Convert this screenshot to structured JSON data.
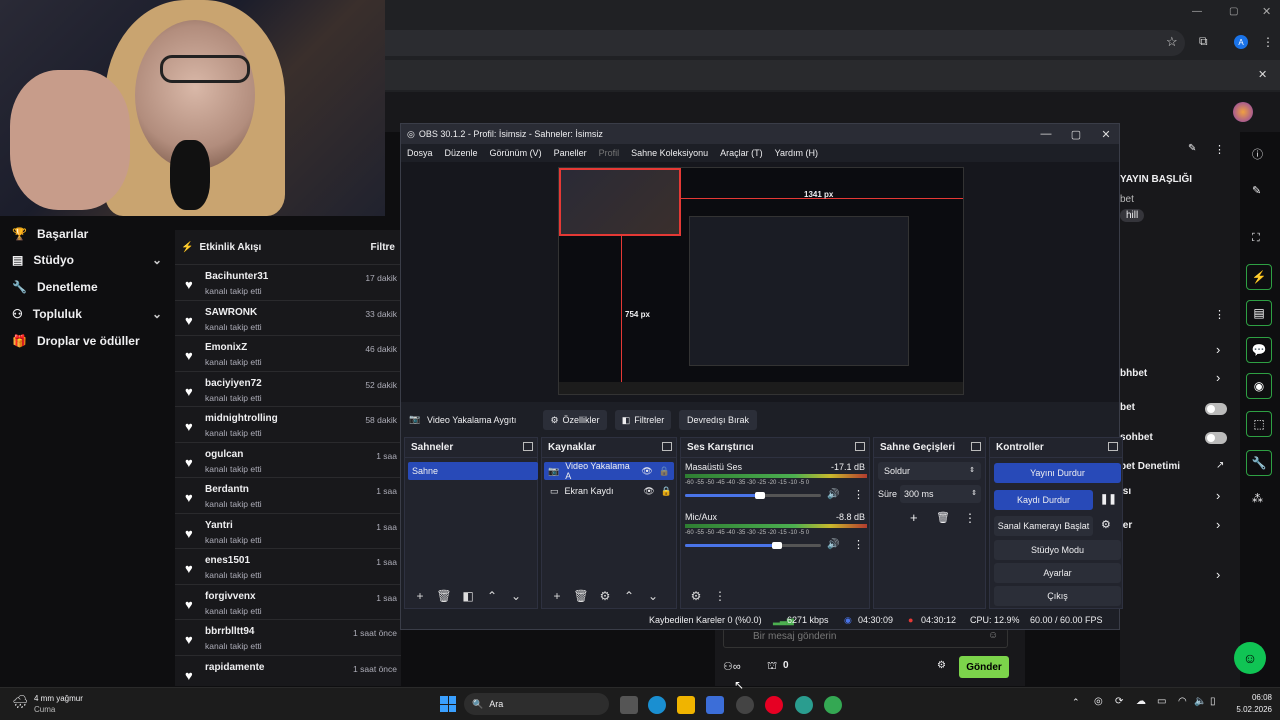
{
  "browser": {
    "avatar_letter": "A"
  },
  "twitch_nav": {
    "items": [
      {
        "label": "Başarılar",
        "icon": "trophy-icon"
      },
      {
        "label": "Stüdyo",
        "icon": "studio-icon"
      },
      {
        "label": "Denetleme",
        "icon": "wrench-icon"
      },
      {
        "label": "Topluluk",
        "icon": "community-icon"
      },
      {
        "label": "Droplar ve ödüller",
        "icon": "gift-icon"
      }
    ]
  },
  "feed": {
    "title": "Etkinlik Akışı",
    "filter": "Filtre",
    "items": [
      {
        "user": "Bacihunter31",
        "status": "kanalı takip etti",
        "time": "17 dakik"
      },
      {
        "user": "SAWRONK",
        "status": "kanalı takip etti",
        "time": "33 dakik"
      },
      {
        "user": "EmonixZ",
        "status": "kanalı takip etti",
        "time": "46 dakik"
      },
      {
        "user": "baciyiyen72",
        "status": "kanalı takip etti",
        "time": "52 dakik"
      },
      {
        "user": "midnightrolling",
        "status": "kanalı takip etti",
        "time": "58 dakik"
      },
      {
        "user": "ogulcan",
        "status": "kanalı takip etti",
        "time": "1 saa"
      },
      {
        "user": "Berdantn",
        "status": "kanalı takip etti",
        "time": "1 saa"
      },
      {
        "user": "Yantri",
        "status": "kanalı takip etti",
        "time": "1 saa"
      },
      {
        "user": "enes1501",
        "status": "kanalı takip etti",
        "time": "1 saa"
      },
      {
        "user": "forgivvenx",
        "status": "kanalı takip etti",
        "time": "1 saa"
      },
      {
        "user": "bbrrblltt94",
        "status": "kanalı takip etti",
        "time": "1 saat önce"
      },
      {
        "user": "rapidamente",
        "status": "",
        "time": "1 saat önce"
      }
    ]
  },
  "right_panel": {
    "title": "YAYIN BAŞLIĞI",
    "line2": "bet",
    "tag": "hill",
    "item1": "bhbet",
    "item2": "bet",
    "item3": "sohbet",
    "item4": "bet Denetimi",
    "item5": "ısı",
    "item6": "ler"
  },
  "chat": {
    "placeholder": "Bir mesaj gönderin",
    "points": "0",
    "send": "Gönder"
  },
  "obs": {
    "title": "OBS 30.1.2 - Profil: İsimsiz - Sahneler: İsimsiz",
    "menu": [
      "Dosya",
      "Düzenle",
      "Görünüm (V)",
      "Paneller",
      "Profil",
      "Sahne Koleksiyonu",
      "Araçlar (T)",
      "Yardım (H)"
    ],
    "preview": {
      "width_label": "1341 px",
      "height_label": "754 px"
    },
    "source_bar": {
      "source": "Video Yakalama Aygıtı",
      "properties": "Özellikler",
      "filters": "Filtreler",
      "deactivate": "Devredışı Bırak"
    },
    "scenes": {
      "title": "Sahneler",
      "items": [
        "Sahne"
      ]
    },
    "sources": {
      "title": "Kaynaklar",
      "items": [
        "Video Yakalama A",
        "Ekran Kaydı"
      ]
    },
    "mixer": {
      "title": "Ses Karıştırıcı",
      "tracks": [
        {
          "name": "Masaüstü Ses",
          "db": "-17.1 dB",
          "level": 0.55
        },
        {
          "name": "Mic/Aux",
          "db": "-8.8 dB",
          "level": 0.68
        }
      ],
      "scale": "-60 -55 -50 -45 -40 -35 -30 -25 -20 -15 -10 -5 0"
    },
    "transitions": {
      "title": "Sahne Geçişleri",
      "type": "Soldur",
      "duration_label": "Süre",
      "duration": "300 ms"
    },
    "controls": {
      "title": "Kontroller",
      "stop_stream": "Yayını Durdur",
      "stop_record": "Kaydı Durdur",
      "virtual_cam": "Sanal Kamerayı Başlat",
      "studio_mode": "Stüdyo Modu",
      "settings": "Ayarlar",
      "exit": "Çıkış"
    },
    "status": {
      "dropped": "Kaybedilen Kareler 0 (%0.0)",
      "bitrate": "6271 kbps",
      "stream_time": "04:30:09",
      "rec_time": "04:30:12",
      "cpu": "CPU: 12.9%",
      "fps": "60.00 / 60.00 FPS"
    }
  },
  "taskbar": {
    "weather_temp": "4 mm yağmur",
    "weather_day": "Cuma",
    "search": "Ara",
    "time": "06:08",
    "date": "5.02.2026"
  }
}
